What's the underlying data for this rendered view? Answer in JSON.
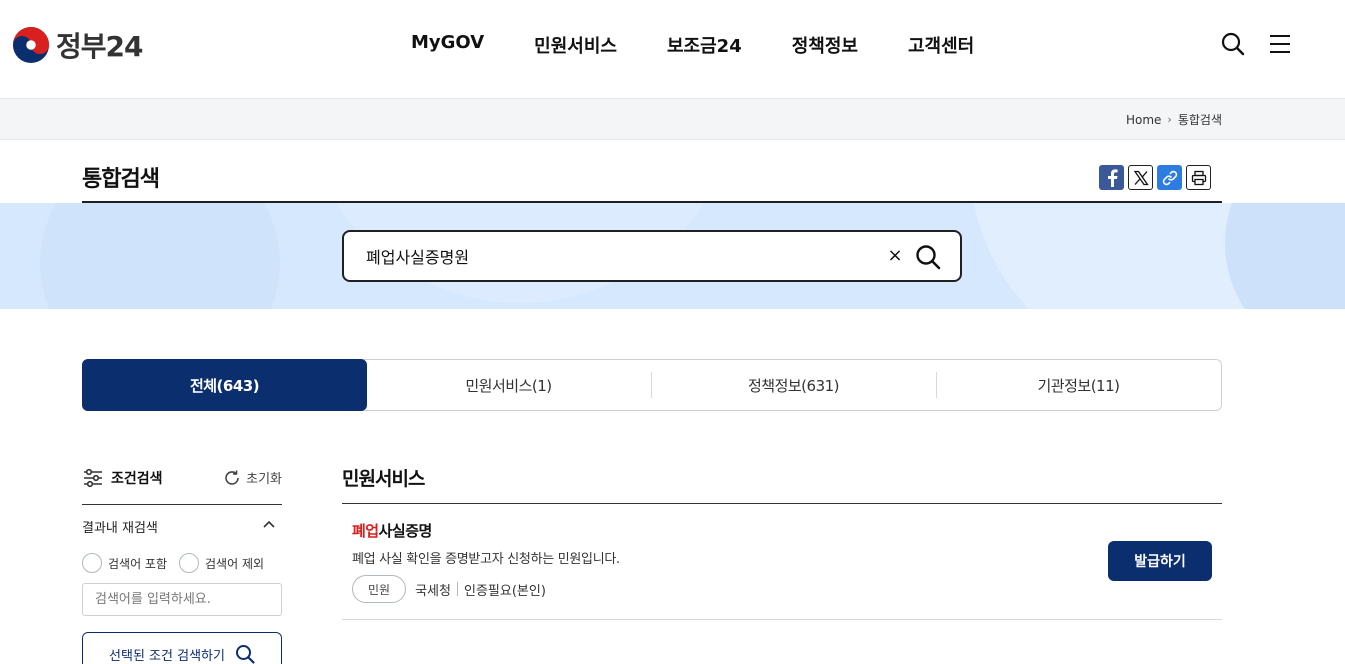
{
  "header": {
    "logo_text": "정부24",
    "nav": [
      "MyGOV",
      "민원서비스",
      "보조금24",
      "정책정보",
      "고객센터"
    ]
  },
  "breadcrumb": {
    "home": "Home",
    "current": "통합검색"
  },
  "page": {
    "title": "통합검색"
  },
  "share": [
    "facebook-icon",
    "x-icon",
    "link-icon",
    "print-icon"
  ],
  "search": {
    "value": "폐업사실증명원",
    "clear_label": "×"
  },
  "tabs": [
    "전체(643)",
    "민원서비스(1)",
    "정책정보(631)",
    "기관정보(11)"
  ],
  "sidebar": {
    "title": "조건검색",
    "reset": "초기화",
    "subtitle": "결과내 재검색",
    "radio_include": "검색어 포함",
    "radio_exclude": "검색어 제외",
    "input_placeholder": "검색어를 입력하세요.",
    "search_button": "선택된 조건 검색하기"
  },
  "results": {
    "section_title": "민원서비스",
    "items": [
      {
        "title_highlight": "폐업",
        "title_rest": "사실증명",
        "description": "폐업 사실 확인을 증명받고자 신청하는 민원입니다.",
        "tag": "민원",
        "agency": "국세청",
        "auth": "인증필요(본인)",
        "button": "발급하기"
      }
    ]
  },
  "colors": {
    "primary": "#0b2e6f",
    "highlight": "#d9201e",
    "search_band": "#d6e8fd"
  }
}
